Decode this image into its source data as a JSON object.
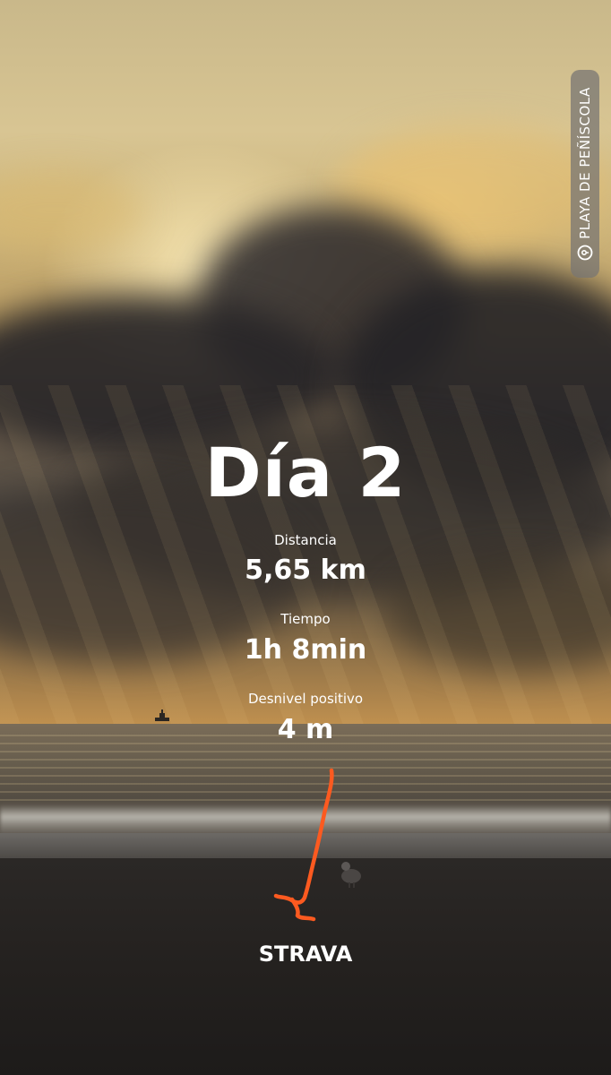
{
  "story": {
    "location": {
      "icon": "location-pin-icon",
      "text": "PLAYA DE PEÑÍSCOLA"
    },
    "title": "Día 2",
    "stats": [
      {
        "label": "Distancia",
        "value": "5,65 km"
      },
      {
        "label": "Tiempo",
        "value": "1h 8min"
      },
      {
        "label": "Desnivel positivo",
        "value": "4 m"
      }
    ],
    "route": {
      "icon": "route-map-icon",
      "color": "#fc5a20"
    },
    "brand": "STRAVA"
  },
  "colors": {
    "text": "#ffffff",
    "route": "#fc5a20",
    "sticker_bg": "#78766f"
  }
}
